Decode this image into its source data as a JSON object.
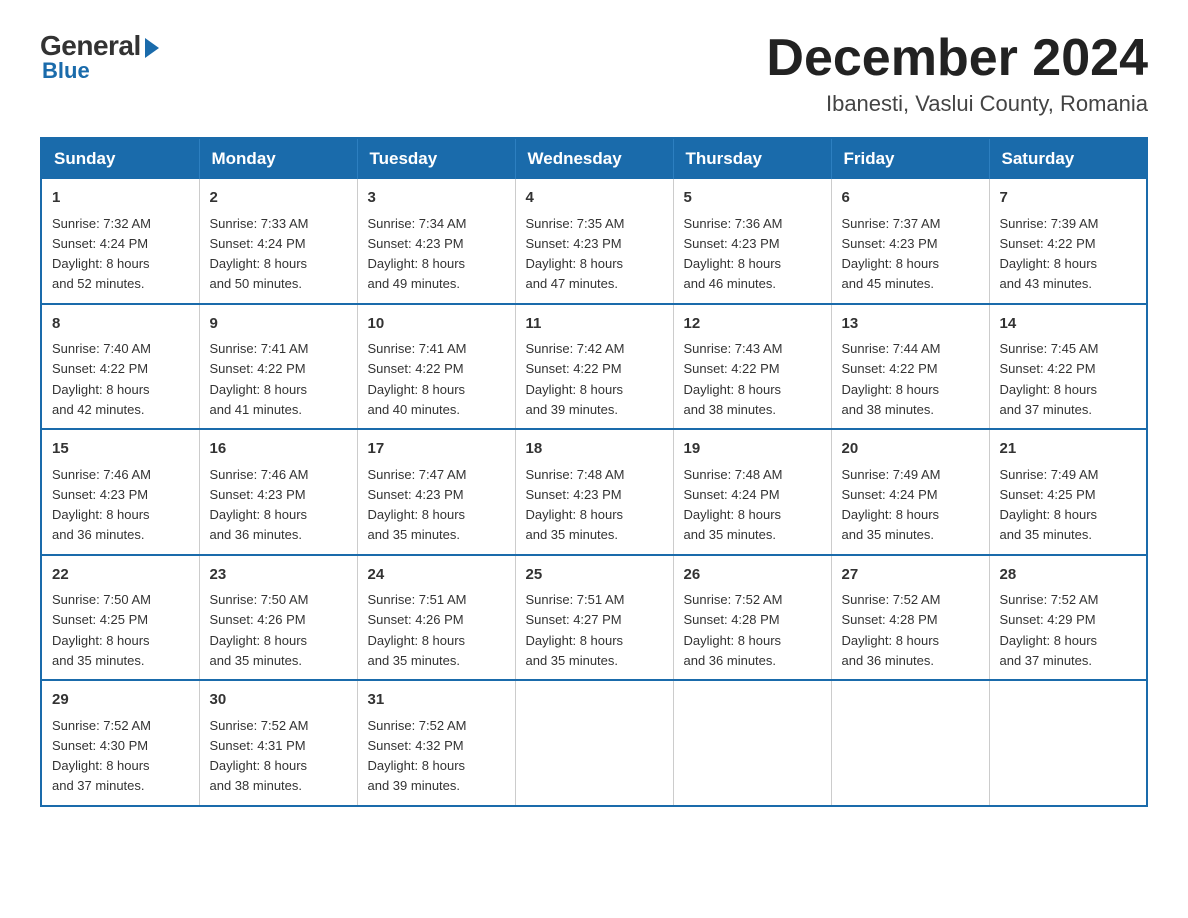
{
  "logo": {
    "general": "General",
    "blue": "Blue"
  },
  "header": {
    "month_year": "December 2024",
    "location": "Ibanesti, Vaslui County, Romania"
  },
  "weekdays": [
    "Sunday",
    "Monday",
    "Tuesday",
    "Wednesday",
    "Thursday",
    "Friday",
    "Saturday"
  ],
  "weeks": [
    [
      {
        "day": "1",
        "sunrise": "7:32 AM",
        "sunset": "4:24 PM",
        "daylight": "8 hours and 52 minutes."
      },
      {
        "day": "2",
        "sunrise": "7:33 AM",
        "sunset": "4:24 PM",
        "daylight": "8 hours and 50 minutes."
      },
      {
        "day": "3",
        "sunrise": "7:34 AM",
        "sunset": "4:23 PM",
        "daylight": "8 hours and 49 minutes."
      },
      {
        "day": "4",
        "sunrise": "7:35 AM",
        "sunset": "4:23 PM",
        "daylight": "8 hours and 47 minutes."
      },
      {
        "day": "5",
        "sunrise": "7:36 AM",
        "sunset": "4:23 PM",
        "daylight": "8 hours and 46 minutes."
      },
      {
        "day": "6",
        "sunrise": "7:37 AM",
        "sunset": "4:23 PM",
        "daylight": "8 hours and 45 minutes."
      },
      {
        "day": "7",
        "sunrise": "7:39 AM",
        "sunset": "4:22 PM",
        "daylight": "8 hours and 43 minutes."
      }
    ],
    [
      {
        "day": "8",
        "sunrise": "7:40 AM",
        "sunset": "4:22 PM",
        "daylight": "8 hours and 42 minutes."
      },
      {
        "day": "9",
        "sunrise": "7:41 AM",
        "sunset": "4:22 PM",
        "daylight": "8 hours and 41 minutes."
      },
      {
        "day": "10",
        "sunrise": "7:41 AM",
        "sunset": "4:22 PM",
        "daylight": "8 hours and 40 minutes."
      },
      {
        "day": "11",
        "sunrise": "7:42 AM",
        "sunset": "4:22 PM",
        "daylight": "8 hours and 39 minutes."
      },
      {
        "day": "12",
        "sunrise": "7:43 AM",
        "sunset": "4:22 PM",
        "daylight": "8 hours and 38 minutes."
      },
      {
        "day": "13",
        "sunrise": "7:44 AM",
        "sunset": "4:22 PM",
        "daylight": "8 hours and 38 minutes."
      },
      {
        "day": "14",
        "sunrise": "7:45 AM",
        "sunset": "4:22 PM",
        "daylight": "8 hours and 37 minutes."
      }
    ],
    [
      {
        "day": "15",
        "sunrise": "7:46 AM",
        "sunset": "4:23 PM",
        "daylight": "8 hours and 36 minutes."
      },
      {
        "day": "16",
        "sunrise": "7:46 AM",
        "sunset": "4:23 PM",
        "daylight": "8 hours and 36 minutes."
      },
      {
        "day": "17",
        "sunrise": "7:47 AM",
        "sunset": "4:23 PM",
        "daylight": "8 hours and 35 minutes."
      },
      {
        "day": "18",
        "sunrise": "7:48 AM",
        "sunset": "4:23 PM",
        "daylight": "8 hours and 35 minutes."
      },
      {
        "day": "19",
        "sunrise": "7:48 AM",
        "sunset": "4:24 PM",
        "daylight": "8 hours and 35 minutes."
      },
      {
        "day": "20",
        "sunrise": "7:49 AM",
        "sunset": "4:24 PM",
        "daylight": "8 hours and 35 minutes."
      },
      {
        "day": "21",
        "sunrise": "7:49 AM",
        "sunset": "4:25 PM",
        "daylight": "8 hours and 35 minutes."
      }
    ],
    [
      {
        "day": "22",
        "sunrise": "7:50 AM",
        "sunset": "4:25 PM",
        "daylight": "8 hours and 35 minutes."
      },
      {
        "day": "23",
        "sunrise": "7:50 AM",
        "sunset": "4:26 PM",
        "daylight": "8 hours and 35 minutes."
      },
      {
        "day": "24",
        "sunrise": "7:51 AM",
        "sunset": "4:26 PM",
        "daylight": "8 hours and 35 minutes."
      },
      {
        "day": "25",
        "sunrise": "7:51 AM",
        "sunset": "4:27 PM",
        "daylight": "8 hours and 35 minutes."
      },
      {
        "day": "26",
        "sunrise": "7:52 AM",
        "sunset": "4:28 PM",
        "daylight": "8 hours and 36 minutes."
      },
      {
        "day": "27",
        "sunrise": "7:52 AM",
        "sunset": "4:28 PM",
        "daylight": "8 hours and 36 minutes."
      },
      {
        "day": "28",
        "sunrise": "7:52 AM",
        "sunset": "4:29 PM",
        "daylight": "8 hours and 37 minutes."
      }
    ],
    [
      {
        "day": "29",
        "sunrise": "7:52 AM",
        "sunset": "4:30 PM",
        "daylight": "8 hours and 37 minutes."
      },
      {
        "day": "30",
        "sunrise": "7:52 AM",
        "sunset": "4:31 PM",
        "daylight": "8 hours and 38 minutes."
      },
      {
        "day": "31",
        "sunrise": "7:52 AM",
        "sunset": "4:32 PM",
        "daylight": "8 hours and 39 minutes."
      },
      null,
      null,
      null,
      null
    ]
  ],
  "labels": {
    "sunrise": "Sunrise:",
    "sunset": "Sunset:",
    "daylight": "Daylight:"
  }
}
